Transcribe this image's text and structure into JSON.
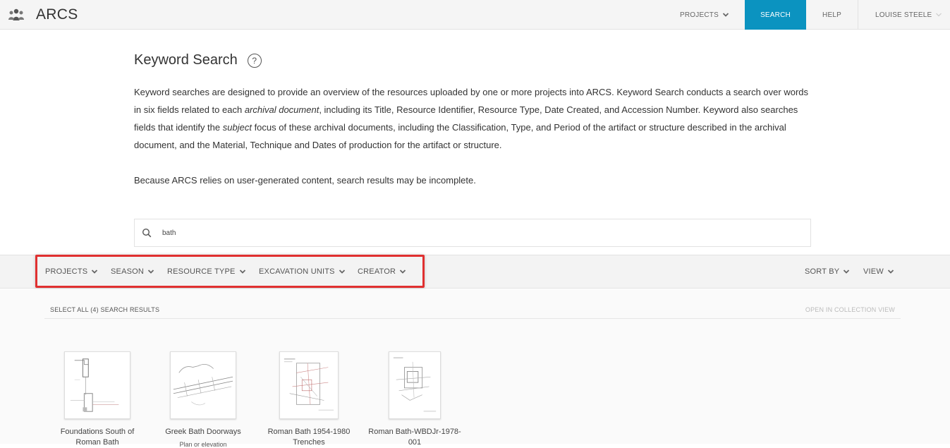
{
  "app": {
    "name": "ARCS"
  },
  "nav": {
    "projects": "PROJECTS",
    "search": "SEARCH",
    "help": "HELP",
    "user": "LOUISE STEELE",
    "active_color": "#0b93c0"
  },
  "page": {
    "title": "Keyword Search",
    "help_glyph": "?",
    "desc_p1_a": "Keyword searches are designed to provide an overview of the resources uploaded by one or more projects into ARCS. Keyword Search conducts a search over words in six fields related to each ",
    "desc_p1_em1": "archival document",
    "desc_p1_b": ", including its Title, Resource Identifier, Resource Type, Date Created, and Accession Number. Keyword also searches fields that identify the ",
    "desc_p1_em2": "subject",
    "desc_p1_c": " focus of these archival documents, including the Classification, Type, and Period of the artifact or structure described in the archival document, and the Material, Technique and Dates of production for the artifact or structure.",
    "desc_p2": "Because ARCS relies on user-generated content, search results may be incomplete."
  },
  "search": {
    "value": "bath",
    "icon": "search-icon"
  },
  "filters": {
    "projects": "PROJECTS",
    "season": "SEASON",
    "resource_type": "RESOURCE TYPE",
    "excavation_units": "EXCAVATION UNITS",
    "creator": "CREATOR",
    "sort_by": "SORT BY",
    "view": "VIEW",
    "highlight_color": "#e03030"
  },
  "results": {
    "select_all": "SELECT ALL (4) SEARCH RESULTS",
    "open_collection": "OPEN IN COLLECTION VIEW",
    "items": [
      {
        "title": "Foundations South of Roman Bath",
        "subtitle": ""
      },
      {
        "title": "Greek Bath Doorways",
        "subtitle": "Plan or elevation"
      },
      {
        "title": "Roman Bath 1954-1980 Trenches",
        "subtitle": ""
      },
      {
        "title": "Roman Bath-WBDJr-1978-001",
        "subtitle": ""
      }
    ]
  }
}
